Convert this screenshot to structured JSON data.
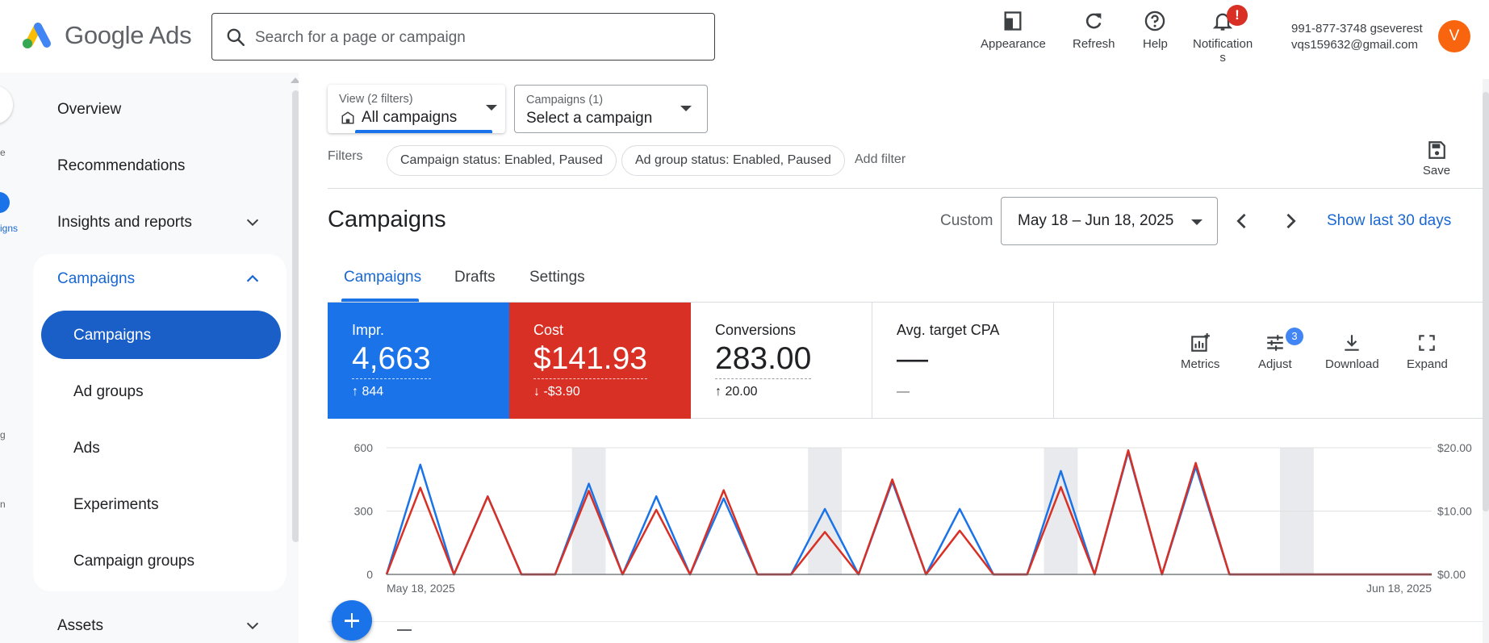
{
  "header": {
    "brand": "Google Ads",
    "search_placeholder": "Search for a page or campaign",
    "buttons": {
      "appearance": "Appearance",
      "refresh": "Refresh",
      "help": "Help",
      "notifications_line1": "Notification",
      "notifications_line2": "s"
    },
    "notification_badge": "!",
    "account": {
      "line1": "991-877-3748 gseverest",
      "line2": "vqs159632@gmail.com",
      "avatar_letter": "V",
      "avatar_color": "#f9650f"
    }
  },
  "rail": {
    "fragments": [
      "e",
      "igns",
      "g",
      "n"
    ]
  },
  "nav": {
    "overview": "Overview",
    "recommendations": "Recommendations",
    "insights": "Insights and reports",
    "campaigns_section": "Campaigns",
    "sub": {
      "campaigns": "Campaigns",
      "ad_groups": "Ad groups",
      "ads": "Ads",
      "experiments": "Experiments",
      "campaign_groups": "Campaign groups"
    },
    "assets": "Assets"
  },
  "main": {
    "view_selector": {
      "small": "View (2 filters)",
      "value": "All campaigns"
    },
    "campaign_selector": {
      "small": "Campaigns (1)",
      "value": "Select a campaign"
    },
    "filters_label": "Filters",
    "chips": [
      "Campaign status: Enabled, Paused",
      "Ad group status: Enabled, Paused"
    ],
    "add_filter": "Add filter",
    "save": "Save",
    "title": "Campaigns",
    "custom": "Custom",
    "date_range": "May 18 – Jun 18, 2025",
    "show_last": "Show last 30 days",
    "tabs": [
      "Campaigns",
      "Drafts",
      "Settings"
    ],
    "metrics": [
      {
        "label": "Impr.",
        "value": "4,663",
        "delta": "↑ 844"
      },
      {
        "label": "Cost",
        "value": "$141.93",
        "delta": "↓ -$3.90"
      },
      {
        "label": "Conversions",
        "value": "283.00",
        "delta": "↑ 20.00"
      },
      {
        "label": "Avg. target CPA",
        "value": "—",
        "delta": "—"
      }
    ],
    "tools": {
      "metrics": "Metrics",
      "adjust": "Adjust",
      "download": "Download",
      "expand": "Expand"
    },
    "adjust_badge": "3"
  },
  "colors": {
    "impr": "#1a73e8",
    "cost": "#d93025",
    "accent": "#1967d2"
  },
  "chart_data": {
    "type": "line",
    "x_start": "May 18, 2025",
    "x_end": "Jun 18, 2025",
    "x": [
      "May 18",
      "May 19",
      "May 20",
      "May 21",
      "May 22",
      "May 23",
      "May 24",
      "May 25",
      "May 26",
      "May 27",
      "May 28",
      "May 29",
      "May 30",
      "May 31",
      "Jun 1",
      "Jun 2",
      "Jun 3",
      "Jun 4",
      "Jun 5",
      "Jun 6",
      "Jun 7",
      "Jun 8",
      "Jun 9",
      "Jun 10",
      "Jun 11",
      "Jun 12",
      "Jun 13",
      "Jun 14",
      "Jun 15",
      "Jun 16",
      "Jun 17",
      "Jun 18"
    ],
    "y_left_ticks": [
      "0",
      "300",
      "600"
    ],
    "y_left_range": [
      0,
      600
    ],
    "y_right_ticks": [
      "$0.00",
      "$10.00",
      "$20.00"
    ],
    "y_right_range": [
      0,
      20
    ],
    "shaded_indices": [
      6,
      13,
      20,
      27
    ],
    "series": [
      {
        "name": "Impr.",
        "axis": "left",
        "values": [
          0,
          520,
          0,
          370,
          0,
          0,
          430,
          0,
          370,
          0,
          360,
          0,
          0,
          310,
          0,
          440,
          0,
          310,
          0,
          0,
          490,
          0,
          580,
          0,
          510,
          0,
          0,
          0,
          0,
          0,
          0,
          0
        ]
      },
      {
        "name": "Cost",
        "axis": "right",
        "values": [
          0,
          13.7,
          0,
          12.3,
          0,
          0,
          13.2,
          0,
          10.2,
          0,
          13.3,
          0,
          0,
          6.7,
          0,
          15.0,
          0,
          6.9,
          0,
          0,
          13.8,
          0,
          19.6,
          0,
          17.6,
          0,
          0,
          0,
          0,
          0,
          0,
          0
        ]
      }
    ]
  }
}
